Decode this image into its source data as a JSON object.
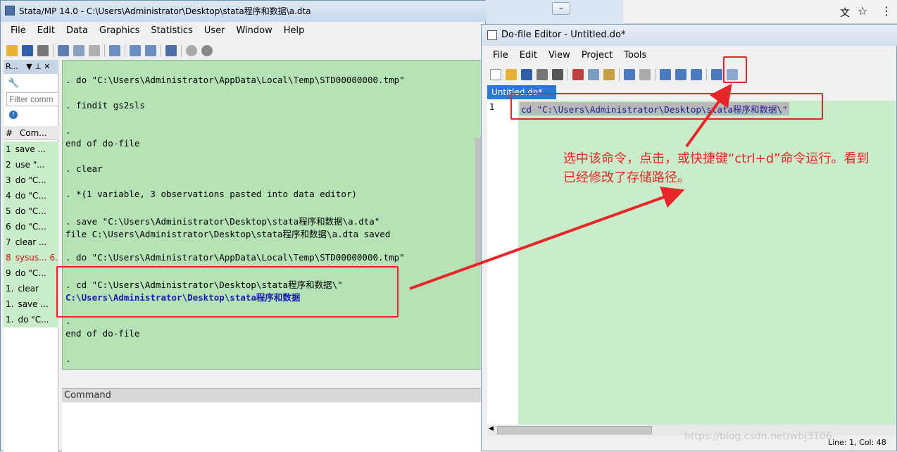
{
  "main": {
    "title": "Stata/MP 14.0 - C:\\Users\\Administrator\\Desktop\\stata程序和数据\\a.dta",
    "menu": [
      "File",
      "Edit",
      "Data",
      "Graphics",
      "Statistics",
      "User",
      "Window",
      "Help"
    ]
  },
  "review": {
    "header": "R...",
    "filter_placeholder": "Filter comm",
    "col_num": "#",
    "col_command": "Com...",
    "col_rc": "_",
    "rows": [
      {
        "num": "1",
        "cmd": "save ...",
        "rc": "",
        "error": false
      },
      {
        "num": "2",
        "cmd": "use \"...",
        "rc": "",
        "error": false
      },
      {
        "num": "3",
        "cmd": "do \"C...",
        "rc": "",
        "error": false
      },
      {
        "num": "4",
        "cmd": "do \"C...",
        "rc": "",
        "error": false
      },
      {
        "num": "5",
        "cmd": "do \"C...",
        "rc": "",
        "error": false
      },
      {
        "num": "6",
        "cmd": "do \"C...",
        "rc": "",
        "error": false
      },
      {
        "num": "7",
        "cmd": "clear ...",
        "rc": "",
        "error": false
      },
      {
        "num": "8",
        "cmd": "sysus...",
        "rc": "6.",
        "error": true
      },
      {
        "num": "9",
        "cmd": "do \"C...",
        "rc": "",
        "error": false
      },
      {
        "num": "1.",
        "cmd": "clear",
        "rc": "",
        "error": false
      },
      {
        "num": "1.",
        "cmd": "save ...",
        "rc": "",
        "error": false
      },
      {
        "num": "1.",
        "cmd": "do \"C...",
        "rc": "",
        "error": false
      }
    ]
  },
  "results": {
    "lines": [
      ". do \"C:\\Users\\Administrator\\AppData\\Local\\Temp\\STD00000000.tmp\"",
      ". findit gs2sls",
      ".",
      "end of do-file",
      ". clear",
      ". *(1 variable, 3 observations pasted into data editor)",
      ". save \"C:\\Users\\Administrator\\Desktop\\stata程序和数据\\a.dta\"",
      "file C:\\Users\\Administrator\\Desktop\\stata程序和数据\\a.dta saved",
      ". do \"C:\\Users\\Administrator\\AppData\\Local\\Temp\\STD00000000.tmp\"",
      ". cd \"C:\\Users\\Administrator\\Desktop\\stata程序和数据\\\"",
      "C:\\Users\\Administrator\\Desktop\\stata程序和数据",
      ".",
      "end of do-file",
      "."
    ]
  },
  "command": {
    "label": "Command"
  },
  "editor": {
    "title": "Do-file Editor - Untitled.do*",
    "menu": [
      "File",
      "Edit",
      "View",
      "Project",
      "Tools"
    ],
    "tab": "Untitled.do*",
    "line_number": "1",
    "code": "cd \"C:\\Users\\Administrator\\Desktop\\stata程序和数据\\\"",
    "status": "Line: 1, Col: 48"
  },
  "annotation": {
    "text": "选中该命令，点击，或快捷键“ctrl+d”命令运行。看到已经修改了存储路径。",
    "color": "#e8262a"
  },
  "watermark": "https://blog.csdn.net/wbj3106"
}
